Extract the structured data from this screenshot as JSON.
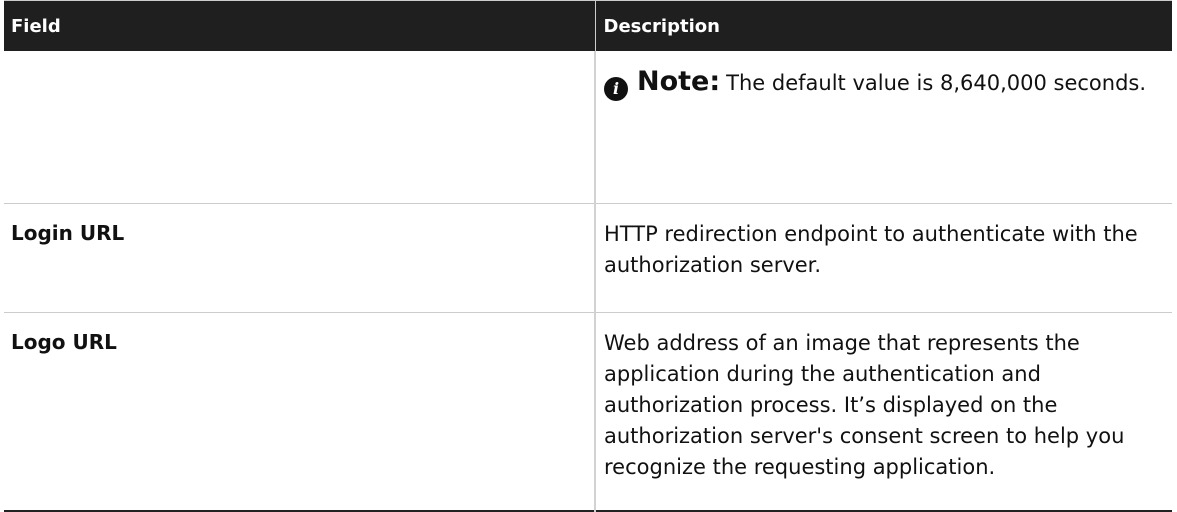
{
  "table": {
    "headers": {
      "field": "Field",
      "description": "Description"
    },
    "note": {
      "label": "Note:",
      "text": "The default value is 8,640,000 seconds.",
      "icon": "info-icon"
    },
    "rows": [
      {
        "field": "Login URL",
        "description": "HTTP redirection endpoint to authenticate with the authorization server."
      },
      {
        "field": "Logo URL",
        "description": "Web address of an image that represents the application during the authentication and authorization process. It’s displayed on the authorization server's consent screen to help you recognize the requesting application."
      }
    ]
  }
}
